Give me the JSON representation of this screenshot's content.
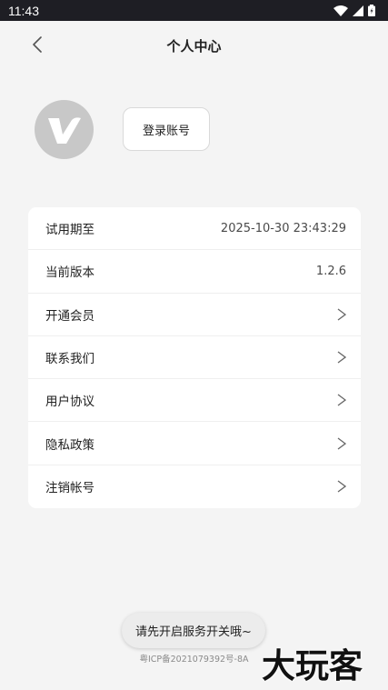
{
  "status_bar": {
    "time": "11:43"
  },
  "header": {
    "title": "个人中心"
  },
  "profile": {
    "avatar_icon": "v-logo-icon",
    "login_label": "登录账号"
  },
  "menu": [
    {
      "label": "试用期至",
      "value": "2025-10-30 23:43:29"
    },
    {
      "label": "当前版本",
      "value": "1.2.6"
    },
    {
      "label": "开通会员",
      "icon": "chevron-right-icon"
    },
    {
      "label": "联系我们",
      "icon": "chevron-right-icon"
    },
    {
      "label": "用户协议",
      "icon": "chevron-right-icon"
    },
    {
      "label": "隐私政策",
      "icon": "chevron-right-icon"
    },
    {
      "label": "注销帐号",
      "icon": "chevron-right-icon"
    }
  ],
  "toast": {
    "text": "请先开启服务开关哦~"
  },
  "footer": {
    "icp": "粤ICP备2021079392号-8A"
  },
  "watermark": {
    "text": "大玩客"
  },
  "colors": {
    "status_bar_bg": "#1e1e24",
    "page_bg": "#f4f4f4",
    "avatar_bg": "#c8c8c8"
  }
}
